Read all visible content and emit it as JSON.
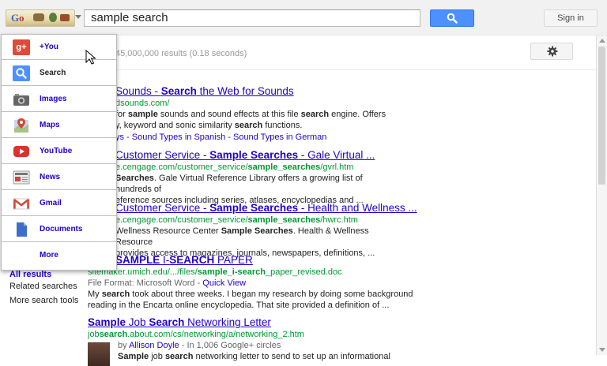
{
  "header": {
    "logo_text": "Google",
    "search_value": "sample search",
    "signin_label": "Sign in"
  },
  "stats": "45,000,000 results (0.18 seconds)",
  "menu": {
    "items": [
      {
        "label": "+You",
        "icon": "google-plus-icon"
      },
      {
        "label": "Search",
        "icon": "search-icon"
      },
      {
        "label": "Images",
        "icon": "camera-icon"
      },
      {
        "label": "Maps",
        "icon": "map-pin-icon"
      },
      {
        "label": "YouTube",
        "icon": "youtube-play-icon"
      },
      {
        "label": "News",
        "icon": "newspaper-icon"
      },
      {
        "label": "Gmail",
        "icon": "gmail-envelope-icon"
      },
      {
        "label": "Documents",
        "icon": "document-icon"
      },
      {
        "label": "More",
        "icon": ""
      }
    ],
    "active_index": 1
  },
  "sidebar": {
    "all_results": "All results",
    "related": "Related searches",
    "more_tools": "More search tools"
  },
  "results": [
    {
      "title_pre": "Sounds - ",
      "title_bold": "Search",
      "title_post": " the Web for Sounds",
      "url": "dsounds.com/",
      "snip1_a": "for ",
      "snip1_b": "sample",
      "snip1_c": " sounds and sound effects at this file ",
      "snip1_d": "search",
      "snip1_e": " engine. Offers",
      "snip2_a": "y, keyword and sonic similarity ",
      "snip2_b": "search",
      "snip2_c": " functions.",
      "links": "ys - Sound Types in Spanish - Sound Types in German"
    },
    {
      "title_pre": "Customer Service - ",
      "title_bold": "Sample Searches",
      "title_post": " - Gale Virtual ...",
      "url_a": "e.cengage.com/customer_service/",
      "url_b": "sample_searches",
      "url_c": "/gvrl.htm",
      "snip1_a": "Searches",
      "snip1_b": ". Gale Virtual Reference Library offers a growing list of hundreds of",
      "snip2": "eference sources including series, atlases, encyclopedias and ..."
    },
    {
      "title_pre": "Customer Service - ",
      "title_bold": "Sample Searches",
      "title_post": " - Health and Wellness ...",
      "url_a": "e.cengage.com/customer_service/",
      "url_b": "sample_searches",
      "url_c": "/hwrc.htm",
      "snip1_a": "Wellness Resource Center ",
      "snip1_b": "Sample Searches",
      "snip1_c": ". Health & Wellness Resource",
      "snip2": "provides access to magazines, journals, newspapers, definitions, ..."
    },
    {
      "title_bold1": "SAMPLE",
      "title_mid": " I-",
      "title_bold2": "SEARCH",
      "title_post": " PAPER",
      "url_a": "sitemaker.umich.edu/.../files/",
      "url_b": "sample_i-search",
      "url_c": "_paper_revised.doc",
      "format_a": "File Format: Microsoft Word - ",
      "format_b": "Quick View",
      "snip1_a": "My ",
      "snip1_b": "search",
      "snip1_c": " took about three weeks. I began my research by doing some background",
      "snip2": "reading in the Encarta online encyclopedia. That site provided a definition of ..."
    },
    {
      "title_bold1": "Sample",
      "title_mid": " Job ",
      "title_bold2": "Search",
      "title_post": " Networking Letter",
      "url_a": "job",
      "url_b": "search",
      "url_c": ".about.com/cs/networking/a/networking_2.htm",
      "by_a": "by ",
      "by_b": "Allison Doyle",
      "by_c": " - In 1,006 Google+ circles",
      "snip1_a": "Sample",
      "snip1_b": " job ",
      "snip1_c": "search",
      "snip1_d": " networking letter to send to set up an informational"
    }
  ]
}
